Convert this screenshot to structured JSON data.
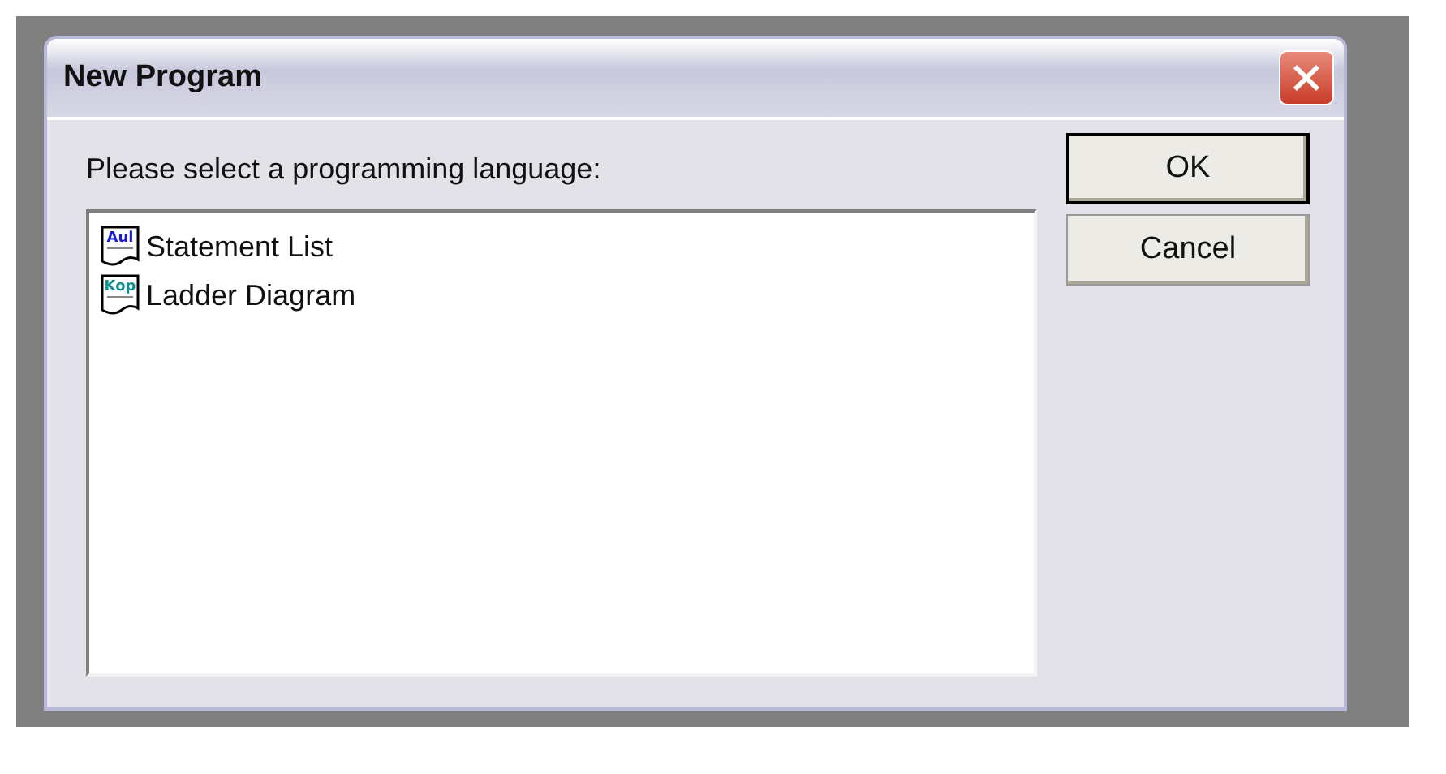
{
  "window": {
    "title": "New Program"
  },
  "prompt": "Please select a programming language:",
  "languages": [
    {
      "name": "Statement List",
      "icon_text": "Aul",
      "color": "#1a1ad0",
      "selected": false
    },
    {
      "name": "Ladder Diagram",
      "icon_text": "Kop",
      "color": "#109090",
      "selected": false
    }
  ],
  "buttons": [
    {
      "label": "OK",
      "default": true
    },
    {
      "label": "Cancel",
      "default": false
    }
  ]
}
